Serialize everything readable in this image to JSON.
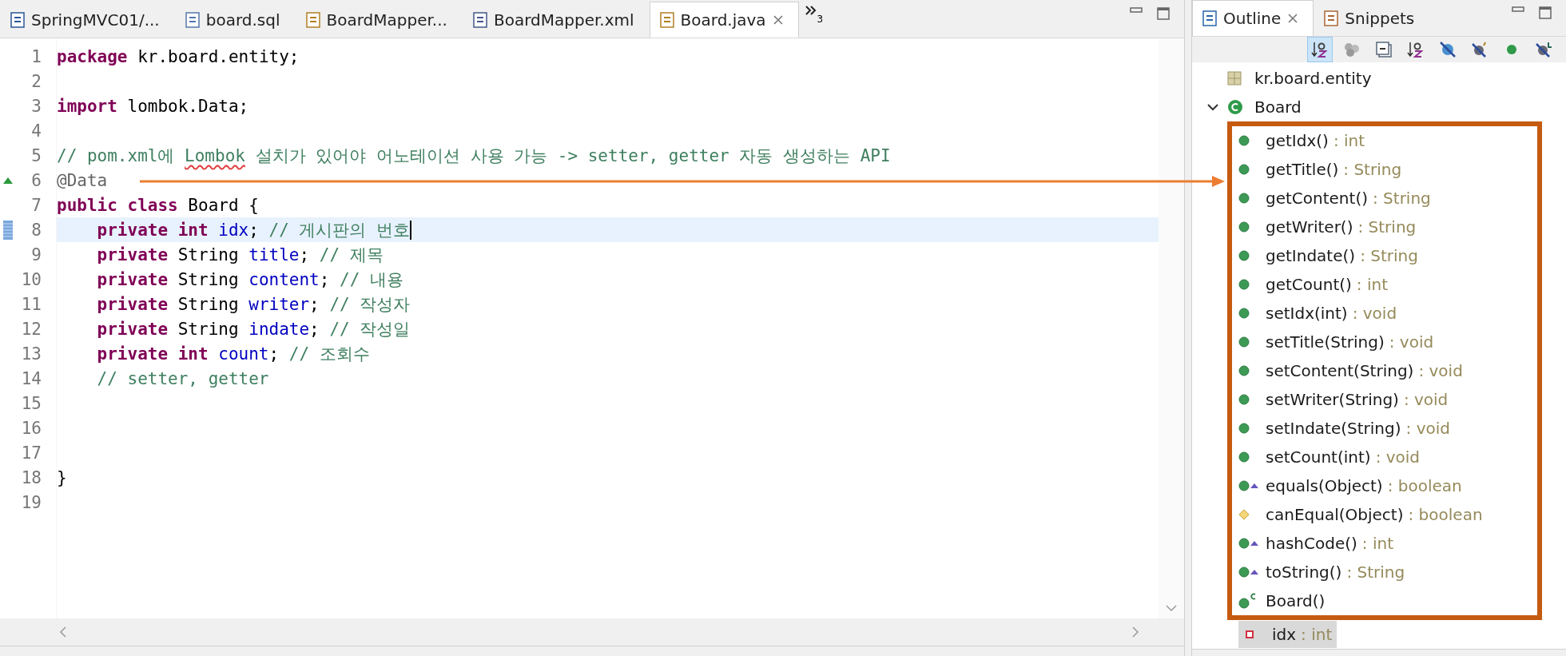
{
  "editor": {
    "tabs": [
      {
        "label": "SpringMVC01/...",
        "kind": "maven",
        "selected": false
      },
      {
        "label": "board.sql",
        "kind": "sql",
        "selected": false
      },
      {
        "label": "BoardMapper...",
        "kind": "java",
        "selected": false
      },
      {
        "label": "BoardMapper.xml",
        "kind": "xml",
        "selected": false
      },
      {
        "label": "Board.java",
        "kind": "java",
        "selected": true
      }
    ],
    "overflow_count": "3",
    "lines": [
      {
        "number": "1",
        "current": false,
        "override_marker": false,
        "tokens": [
          {
            "kind": "keyword",
            "text": "package"
          },
          {
            "kind": "plain",
            "text": " kr.board.entity;"
          }
        ]
      },
      {
        "number": "2",
        "current": false,
        "override_marker": false
      },
      {
        "number": "3",
        "current": false,
        "override_marker": false,
        "tokens": [
          {
            "kind": "keyword",
            "text": "import"
          },
          {
            "kind": "plain",
            "text": " lombok.Data;"
          }
        ]
      },
      {
        "number": "4",
        "current": false,
        "override_marker": false
      },
      {
        "number": "5",
        "current": false,
        "override_marker": false,
        "tokens": [
          {
            "kind": "comment",
            "text": "// pom.xml에 "
          },
          {
            "kind": "misspelled",
            "text": "Lombok"
          },
          {
            "kind": "comment",
            "text": " 설치가 있어야 어노테이션 사용 가능 -> setter, getter 자동 생성하는 API"
          }
        ]
      },
      {
        "number": "6",
        "current": false,
        "override_marker": true,
        "tokens": [
          {
            "kind": "annotation",
            "text": "@Data"
          }
        ]
      },
      {
        "number": "7",
        "current": false,
        "override_marker": false,
        "tokens": [
          {
            "kind": "keyword",
            "text": "public class"
          },
          {
            "kind": "plain",
            "text": " Board {"
          }
        ]
      },
      {
        "number": "8",
        "current": true,
        "override_marker": false,
        "tokens": [
          {
            "kind": "keyword",
            "text": "    private int"
          },
          {
            "kind": "field",
            "text": " idx"
          },
          {
            "kind": "plain",
            "text": "; "
          },
          {
            "kind": "comment",
            "text": "// 게시판의 번호"
          }
        ]
      },
      {
        "number": "9",
        "current": false,
        "override_marker": false,
        "tokens": [
          {
            "kind": "keyword",
            "text": "    private"
          },
          {
            "kind": "plain",
            "text": " String "
          },
          {
            "kind": "field",
            "text": "title"
          },
          {
            "kind": "plain",
            "text": "; "
          },
          {
            "kind": "comment",
            "text": "// 제목"
          }
        ]
      },
      {
        "number": "10",
        "current": false,
        "override_marker": false,
        "tokens": [
          {
            "kind": "keyword",
            "text": "    private"
          },
          {
            "kind": "plain",
            "text": " String "
          },
          {
            "kind": "field",
            "text": "content"
          },
          {
            "kind": "plain",
            "text": "; "
          },
          {
            "kind": "comment",
            "text": "// 내용"
          }
        ]
      },
      {
        "number": "11",
        "current": false,
        "override_marker": false,
        "tokens": [
          {
            "kind": "keyword",
            "text": "    private"
          },
          {
            "kind": "plain",
            "text": " String "
          },
          {
            "kind": "field",
            "text": "writer"
          },
          {
            "kind": "plain",
            "text": "; "
          },
          {
            "kind": "comment",
            "text": "// 작성자"
          }
        ]
      },
      {
        "number": "12",
        "current": false,
        "override_marker": false,
        "tokens": [
          {
            "kind": "keyword",
            "text": "    private"
          },
          {
            "kind": "plain",
            "text": " String "
          },
          {
            "kind": "field",
            "text": "indate"
          },
          {
            "kind": "plain",
            "text": "; "
          },
          {
            "kind": "comment",
            "text": "// 작성일"
          }
        ]
      },
      {
        "number": "13",
        "current": false,
        "override_marker": false,
        "tokens": [
          {
            "kind": "keyword",
            "text": "    private int"
          },
          {
            "kind": "field",
            "text": " count"
          },
          {
            "kind": "plain",
            "text": "; "
          },
          {
            "kind": "comment",
            "text": "// 조회수"
          }
        ]
      },
      {
        "number": "14",
        "current": false,
        "override_marker": false,
        "tokens": [
          {
            "kind": "comment",
            "text": "    // setter, getter"
          }
        ]
      },
      {
        "number": "15",
        "current": false,
        "override_marker": false
      },
      {
        "number": "16",
        "current": false,
        "override_marker": false
      },
      {
        "number": "17",
        "current": false,
        "override_marker": false
      },
      {
        "number": "18",
        "current": false,
        "override_marker": false,
        "tokens": [
          {
            "kind": "plain",
            "text": "}"
          }
        ]
      },
      {
        "number": "19",
        "current": false,
        "override_marker": false
      }
    ]
  },
  "outline": {
    "tabs": [
      {
        "label": "Outline",
        "kind": "outline",
        "selected": true
      },
      {
        "label": "Snippets",
        "kind": "snippets",
        "selected": false
      }
    ],
    "toolbar": [
      {
        "kind": "sort",
        "pressed": true
      },
      {
        "kind": "group",
        "pressed": false
      },
      {
        "kind": "collapse",
        "pressed": false
      },
      {
        "kind": "sort",
        "pressed": false
      },
      {
        "kind": "hide-fields",
        "pressed": false
      },
      {
        "kind": "hide-static",
        "pressed": false
      },
      {
        "kind": "public",
        "pressed": false
      },
      {
        "kind": "hide-local",
        "pressed": false
      }
    ],
    "package": {
      "name": "kr.board.entity"
    },
    "class": {
      "name": "Board",
      "expanded": true,
      "framed_members": [
        {
          "name": "getIdx()",
          "type": ": int",
          "kind": "public",
          "override": false,
          "selected": false
        },
        {
          "name": "getTitle()",
          "type": ": String",
          "kind": "public",
          "override": false,
          "selected": false
        },
        {
          "name": "getContent()",
          "type": ": String",
          "kind": "public",
          "override": false,
          "selected": false
        },
        {
          "name": "getWriter()",
          "type": ": String",
          "kind": "public",
          "override": false,
          "selected": false
        },
        {
          "name": "getIndate()",
          "type": ": String",
          "kind": "public",
          "override": false,
          "selected": false
        },
        {
          "name": "getCount()",
          "type": ": int",
          "kind": "public",
          "override": false,
          "selected": false
        },
        {
          "name": "setIdx(int)",
          "type": ": void",
          "kind": "public",
          "override": false,
          "selected": false
        },
        {
          "name": "setTitle(String)",
          "type": ": void",
          "kind": "public",
          "override": false,
          "selected": false
        },
        {
          "name": "setContent(String)",
          "type": ": void",
          "kind": "public",
          "override": false,
          "selected": false
        },
        {
          "name": "setWriter(String)",
          "type": ": void",
          "kind": "public",
          "override": false,
          "selected": false
        },
        {
          "name": "setIndate(String)",
          "type": ": void",
          "kind": "public",
          "override": false,
          "selected": false
        },
        {
          "name": "setCount(int)",
          "type": ": void",
          "kind": "public",
          "override": false,
          "selected": false
        },
        {
          "name": "equals(Object)",
          "type": ": boolean",
          "kind": "public",
          "override": true,
          "selected": false
        },
        {
          "name": "canEqual(Object)",
          "type": ": boolean",
          "kind": "protected",
          "override": false,
          "selected": false
        },
        {
          "name": "hashCode()",
          "type": ": int",
          "kind": "public",
          "override": true,
          "selected": false
        },
        {
          "name": "toString()",
          "type": ": String",
          "kind": "public",
          "override": true,
          "selected": false
        },
        {
          "name": "Board()",
          "kind": "constructor",
          "override": false,
          "selected": false
        }
      ],
      "members": [
        {
          "name": "idx",
          "type": ": int",
          "kind": "private-field",
          "override": false,
          "selected": true
        }
      ]
    }
  }
}
